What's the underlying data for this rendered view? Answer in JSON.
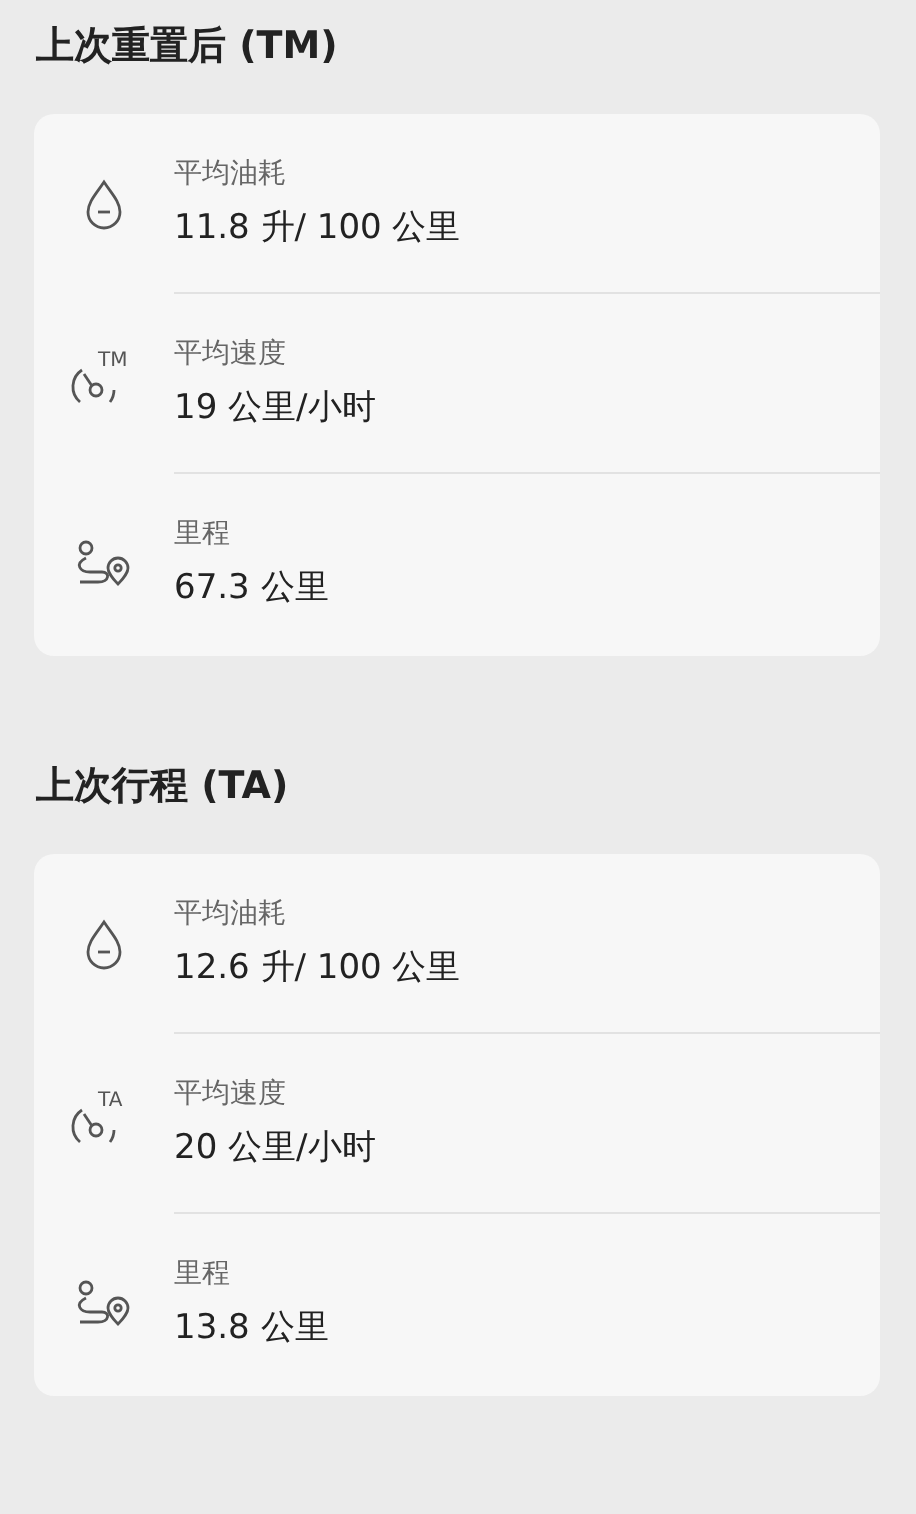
{
  "sections": [
    {
      "title": "上次重置后 (TM)",
      "rows": [
        {
          "kind": "fuel",
          "label": "平均油耗",
          "value": "11.8 升/ 100 公里"
        },
        {
          "kind": "speed",
          "icon_text": "TM",
          "label": "平均速度",
          "value": "19 公里/小时"
        },
        {
          "kind": "distance",
          "label": "里程",
          "value": "67.3 公里"
        }
      ]
    },
    {
      "title": "上次行程 (TA)",
      "rows": [
        {
          "kind": "fuel",
          "label": "平均油耗",
          "value": "12.6 升/ 100 公里"
        },
        {
          "kind": "speed",
          "icon_text": "TA",
          "label": "平均速度",
          "value": "20 公里/小时"
        },
        {
          "kind": "distance",
          "label": "里程",
          "value": "13.8 公里"
        }
      ]
    }
  ]
}
